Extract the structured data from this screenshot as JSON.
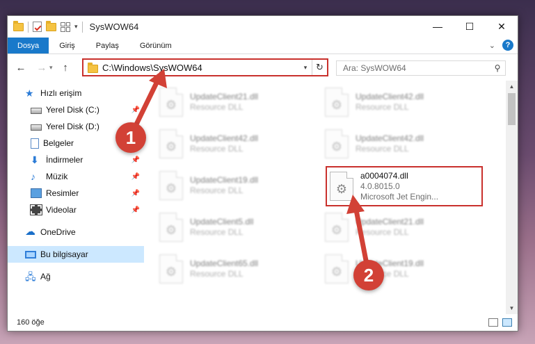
{
  "window": {
    "title": "SysWOW64",
    "controls": {
      "minimize": "—",
      "maximize": "☐",
      "close": "✕"
    }
  },
  "ribbon": {
    "tabs": [
      "Dosya",
      "Giriş",
      "Paylaş",
      "Görünüm"
    ],
    "help": "?"
  },
  "address": {
    "path": "C:\\Windows\\SysWOW64",
    "refresh": "↻"
  },
  "search": {
    "placeholder": "Ara: SysWOW64"
  },
  "sidebar": {
    "items": [
      {
        "label": "Hızlı erişim",
        "icon": "star-icon"
      },
      {
        "label": "Yerel Disk (C:)",
        "icon": "drive-icon",
        "pinned": true
      },
      {
        "label": "Yerel Disk (D:)",
        "icon": "drive-icon",
        "pinned": false
      },
      {
        "label": "Belgeler",
        "icon": "documents-icon",
        "pinned": true
      },
      {
        "label": "İndirmeler",
        "icon": "download-icon",
        "pinned": true
      },
      {
        "label": "Müzik",
        "icon": "music-icon",
        "pinned": true
      },
      {
        "label": "Resimler",
        "icon": "pictures-icon",
        "pinned": true
      },
      {
        "label": "Videolar",
        "icon": "videos-icon",
        "pinned": true
      },
      {
        "label": "OneDrive",
        "icon": "cloud-icon"
      },
      {
        "label": "Bu bilgisayar",
        "icon": "pc-icon",
        "selected": true
      },
      {
        "label": "Ağ",
        "icon": "network-icon"
      }
    ]
  },
  "files": [
    {
      "name": "UpdateClient21.dll",
      "desc": "Resource DLL"
    },
    {
      "name": "UpdateClient42.dll",
      "desc": "Resource DLL"
    },
    {
      "name": "UpdateClient42.dll",
      "desc": "Resource DLL"
    },
    {
      "name": "UpdateClient42.dll",
      "desc": "Resource DLL"
    },
    {
      "name": "UpdateClient19.dll",
      "desc": "Resource DLL"
    },
    {
      "name": "a0004074.dll",
      "version": "4.0.8015.0",
      "desc": "Microsoft Jet Engin...",
      "highlighted": true
    },
    {
      "name": "UpdateClient5.dll",
      "desc": "Resource DLL"
    },
    {
      "name": "UpdateClient21.dll",
      "desc": "Resource DLL"
    },
    {
      "name": "UpdateClient65.dll",
      "desc": "Resource DLL"
    },
    {
      "name": "UpdateClient19.dll",
      "desc": "Resource DLL"
    }
  ],
  "status": {
    "count": "160 öğe"
  },
  "annotations": {
    "step1": "1",
    "step2": "2"
  },
  "colors": {
    "accent": "#1979ca",
    "highlight": "#c9302c",
    "selected": "#cce8ff"
  }
}
